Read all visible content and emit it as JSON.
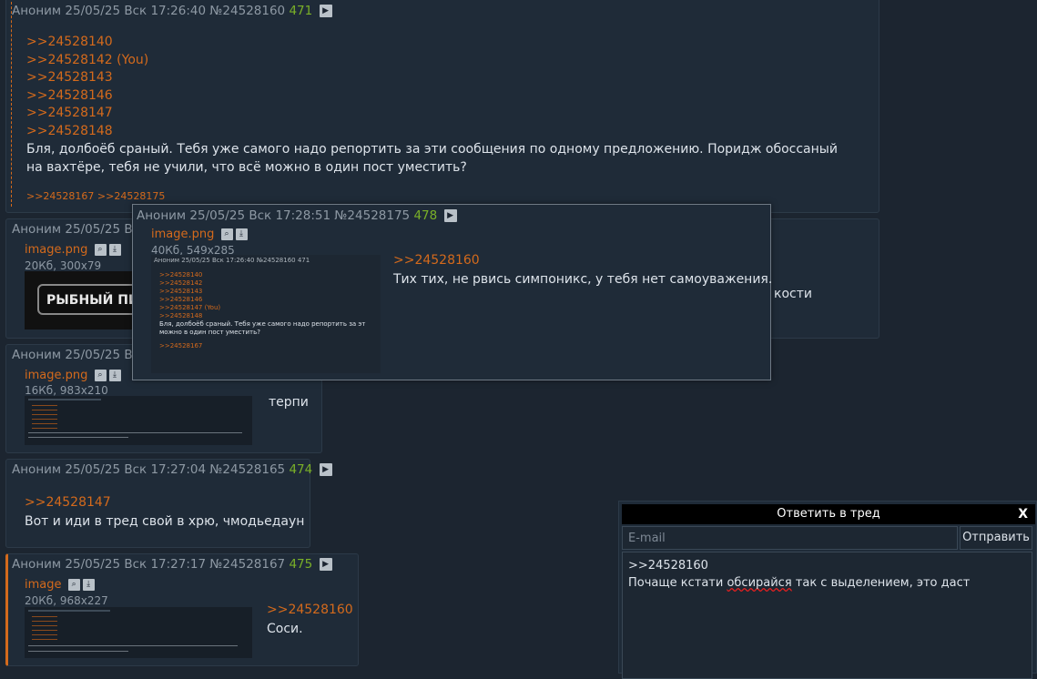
{
  "posts": {
    "p1": {
      "author": "Аноним",
      "date": "25/05/25 Вск 17:26:40",
      "num": "№24528160",
      "count": "471",
      "replies": [
        ">>24528140",
        ">>24528142 (You)",
        ">>24528143",
        ">>24528146",
        ">>24528147",
        ">>24528148"
      ],
      "text": "Бля, долбоёб сраный. Тебя уже самого надо репортить за эти сообщения по одному предложению. Поридж обоссаный на вахтёре, тебя не учили, что всё можно в один пост уместить?",
      "backlinks": ">>24528167 >>24528175"
    },
    "p2": {
      "author": "Аноним",
      "date": "25/05/25 Вс",
      "file": "image.png",
      "meta": "20Кб, 300x79",
      "thumb_text": "РЫБНЫЙ ПИ",
      "text_tail": "кости"
    },
    "p3": {
      "author": "Аноним",
      "date": "25/05/25 Вс",
      "file": "image.png",
      "meta": "16Кб, 983x210",
      "text": "терпи"
    },
    "p4": {
      "author": "Аноним",
      "date": "25/05/25 Вск 17:27:04",
      "num": "№24528165",
      "count": "474",
      "reply": ">>24528147",
      "text": "Вот и иди в тред свой в хрю, чмодьедаун"
    },
    "p5": {
      "author": "Аноним",
      "date": "25/05/25 Вск 17:27:17",
      "num": "№24528167",
      "count": "475",
      "file": "image",
      "meta": "20Кб, 968x227",
      "reply": ">>24528160",
      "text": "Соси."
    }
  },
  "popup": {
    "author": "Аноним",
    "date": "25/05/25 Вск 17:28:51",
    "num": "№24528175",
    "count": "478",
    "file": "image.png",
    "meta": "40Кб, 549x285",
    "reply": ">>24528160",
    "text": "Тих тих, не рвись симпоникс, у тебя нет самоуважения.",
    "thumb": {
      "hdr": "Аноним 25/05/25 Вск 17:26:40 №24528160 471",
      "replies": [
        ">>24528140",
        ">>24528142",
        ">>24528143",
        ">>24528146",
        ">>24528147 (You)",
        ">>24528148"
      ],
      "line1": "Бля, долбоёб сраный. Тебя уже самого надо репортить за эт",
      "line2": "можно в один пост уместить?",
      "backlink": ">>24528167"
    }
  },
  "form": {
    "title": "Ответить в тред",
    "close": "X",
    "email_placeholder": "E-mail",
    "submit": "Отправить",
    "body_line1": ">>24528160",
    "body_line2_a": "Почаще кстати ",
    "body_line2_b": "обсирайся",
    "body_line2_c": " так с выделением, это даст"
  },
  "icons": {
    "play": "play-icon",
    "zoom": "zoom-icon",
    "download": "download-icon"
  },
  "colors": {
    "accent": "#d46a1c",
    "counter": "#7ab028",
    "bg": "#1c2530",
    "post_bg": "#1f2b38"
  }
}
